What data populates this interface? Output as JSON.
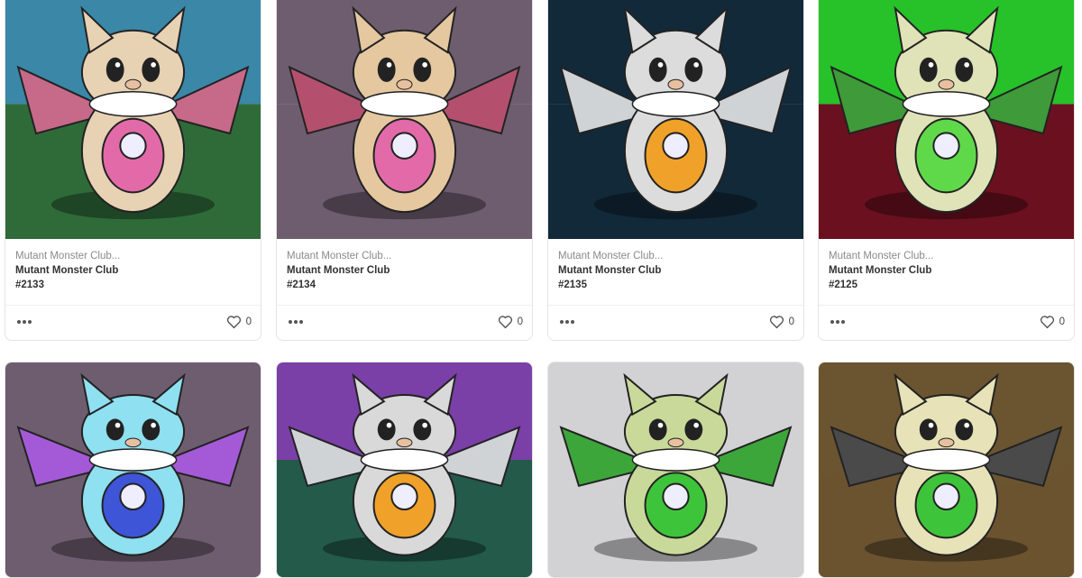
{
  "grid": {
    "cards": [
      {
        "collection": "Mutant Monster Club...",
        "title": "Mutant Monster Club",
        "number": "#2133",
        "likes": "0",
        "bg": "#2f6b39",
        "sky": "#3a87a8",
        "body": "#e8d2b4",
        "accent": "#e26aa8",
        "wing": "#c76a8a",
        "icon": "monster-avatar-image"
      },
      {
        "collection": "Mutant Monster Club...",
        "title": "Mutant Monster Club",
        "number": "#2134",
        "likes": "0",
        "bg": "#6e5d6f",
        "sky": "#6e5d6f",
        "body": "#e5c8a0",
        "accent": "#e26aa8",
        "wing": "#b4506e",
        "icon": "monster-avatar-image"
      },
      {
        "collection": "Mutant Monster Club...",
        "title": "Mutant Monster Club",
        "number": "#2135",
        "likes": "0",
        "bg": "#12293a",
        "sky": "#12293a",
        "body": "#dcdcdc",
        "accent": "#f0a12a",
        "wing": "#cfd3d6",
        "icon": "monster-avatar-image"
      },
      {
        "collection": "Mutant Monster Club...",
        "title": "Mutant Monster Club",
        "number": "#2125",
        "likes": "0",
        "bg": "#6b1020",
        "sky": "#27c12a",
        "body": "#e0e3b8",
        "accent": "#5fd94a",
        "wing": "#3f9a3a",
        "icon": "monster-avatar-image"
      },
      {
        "bg": "#6e5d6f",
        "sky": "#6e5d6f",
        "body": "#8fe0f0",
        "accent": "#3d55d6",
        "wing": "#a45ad6",
        "icon": "monster-avatar-image"
      },
      {
        "bg": "#235a4a",
        "sky": "#7b3fa8",
        "body": "#d9d9d9",
        "accent": "#f0a12a",
        "wing": "#cfd3d6",
        "icon": "monster-avatar-image"
      },
      {
        "bg": "#d2d2d4",
        "sky": "#d2d2d4",
        "body": "#c9d99a",
        "accent": "#3ec43a",
        "wing": "#3ca63a",
        "icon": "monster-avatar-image"
      },
      {
        "bg": "#6b5430",
        "sky": "#6b5430",
        "body": "#e7e2b8",
        "accent": "#3ec43a",
        "wing": "#4a4a4a",
        "icon": "monster-avatar-image"
      }
    ]
  },
  "icons": {
    "more": "more-dots-icon",
    "like": "heart-icon"
  }
}
